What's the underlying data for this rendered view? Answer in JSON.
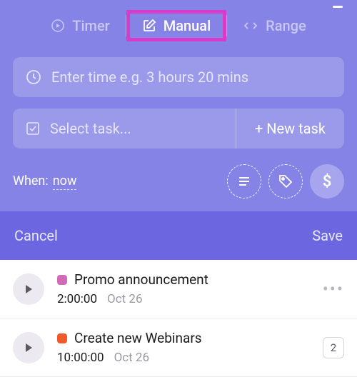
{
  "tabs": {
    "timer": "Timer",
    "manual": "Manual",
    "range": "Range"
  },
  "timeInput": {
    "placeholder": "Enter time e.g. 3 hours 20 mins"
  },
  "taskSelect": {
    "placeholder": "Select task...",
    "newTask": "+ New task"
  },
  "when": {
    "label": "When:",
    "value": "now"
  },
  "dollarSign": "$",
  "actions": {
    "cancel": "Cancel",
    "save": "Save"
  },
  "entries": [
    {
      "color": "#d16bb5",
      "title": "Promo announcement",
      "duration": "2:00:00",
      "date": "Oct 26",
      "trail": "more"
    },
    {
      "color": "#f0592b",
      "title": "Create new Webinars",
      "duration": "10:00:00",
      "date": "Oct 26",
      "trail": "count",
      "count": "2"
    }
  ]
}
